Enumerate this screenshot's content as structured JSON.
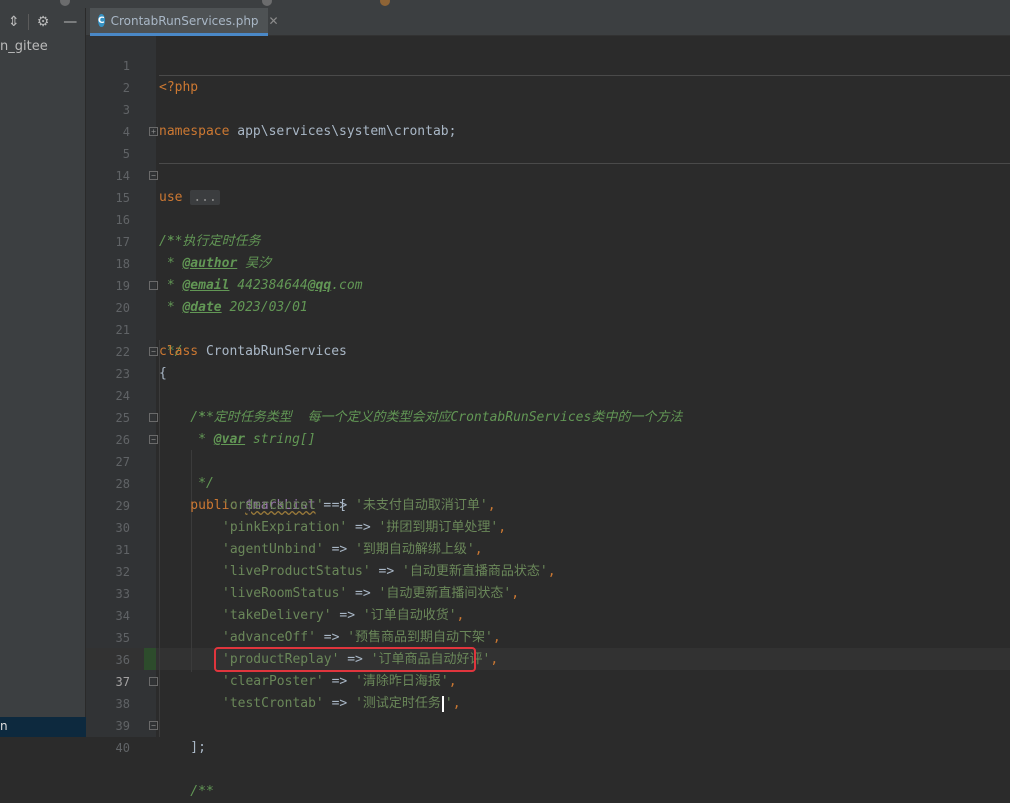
{
  "tab": {
    "label": "CrontabRunServices.php",
    "icon": "C"
  },
  "project": {
    "item_label": "n_gitee"
  },
  "toolbar": {
    "collapse_icon": "collapse-icon",
    "settings_icon": "gear-icon",
    "hide_icon": "minus-icon"
  },
  "editor": {
    "line_numbers": [
      "1",
      "2",
      "3",
      "4",
      "5",
      "14",
      "15",
      "16",
      "17",
      "18",
      "19",
      "20",
      "21",
      "22",
      "23",
      "24",
      "25",
      "26",
      "27",
      "28",
      "29",
      "30",
      "31",
      "32",
      "33",
      "34",
      "35",
      "36",
      "37",
      "38",
      "39",
      "40"
    ],
    "current_line": "37",
    "code": {
      "l1": "<?php",
      "l3_kw": "namespace",
      "l3_rest": " app\\services\\system\\crontab;",
      "l5_kw": "use",
      "l5_fold": "...",
      "l15": "/**",
      "l16": " * 执行定时任务",
      "l17_pre": " * ",
      "l17_tag": "@author",
      "l17_rest": " 吴汐",
      "l18_pre": " * ",
      "l18_tag": "@email",
      "l18_rest_a": " 442384644",
      "l18_rest_b": "@qq",
      "l18_rest_c": ".com",
      "l19_pre": " * ",
      "l19_tag": "@date",
      "l19_rest": " 2023/03/01",
      "l20": " */",
      "l21_kw": "class",
      "l21_rest": " CrontabRunServices",
      "l22": "{",
      "l23": "    /**",
      "l24_a": "     * 定时任务类型  每一个定义的类型会对应",
      "l24_b": "CrontabRunServices",
      "l24_c": "类中的一个方法",
      "l25_pre": "     * ",
      "l25_tag": "@var",
      "l25_rest": " string[]",
      "l26": "     */",
      "l27_kw": "    public",
      "l27_var": "$markList",
      "l27_rest": " = [",
      "l28_k": "'orderCancel'",
      "l28_v": "'未支付自动取消订单'",
      "l29_k": "'pinkExpiration'",
      "l29_v": "'拼团到期订单处理'",
      "l30_k": "'agentUnbind'",
      "l30_v": "'到期自动解绑上级'",
      "l31_k": "'liveProductStatus'",
      "l31_v": "'自动更新直播商品状态'",
      "l32_k": "'liveRoomStatus'",
      "l32_v": "'自动更新直播间状态'",
      "l33_k": "'takeDelivery'",
      "l33_v": "'订单自动收货'",
      "l34_k": "'advanceOff'",
      "l34_v": "'预售商品到期自动下架'",
      "l35_k": "'productReplay'",
      "l35_v": "'订单商品自动好评'",
      "l36_k": "'clearPoster'",
      "l36_v": "'清除昨日海报'",
      "l37_k": "'testCrontab'",
      "l37_v_a": "'测试定时任务",
      "l37_v_b": "'",
      "arrow": " => ",
      "comma": ",",
      "l38": "    ];",
      "l40": "    /**"
    }
  },
  "colors": {
    "keyword": "#cc7832",
    "string": "#6a8759",
    "doc": "#629755",
    "highlight": "#e0353d"
  }
}
